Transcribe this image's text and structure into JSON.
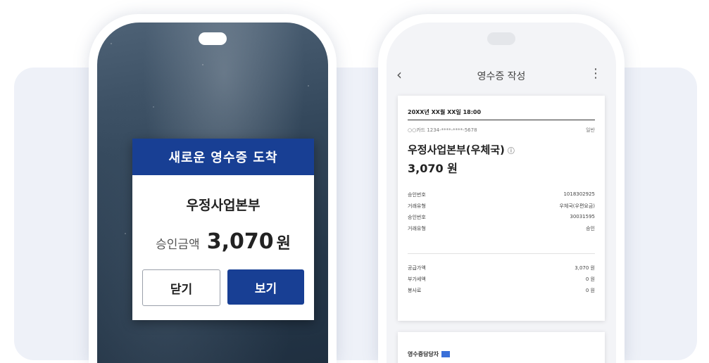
{
  "popup": {
    "title": "새로운 영수증 도착",
    "merchant": "우정사업본부",
    "amount_label": "승인금액",
    "amount_value": "3,070",
    "amount_unit": "원",
    "close_label": "닫기",
    "view_label": "보기"
  },
  "app": {
    "title": "영수증 작성"
  },
  "receipt": {
    "date": "20XX년 XX월 XX일 18:00",
    "card": "○○카드 1234-****-****-5678",
    "payment_type": "일반",
    "merchant": "우정사업본부(우체국)",
    "total": "3,070 원",
    "rows": [
      {
        "label": "승인번호",
        "value": "1018302925"
      },
      {
        "label": "거래유형",
        "value": "우체국(우편요금)"
      },
      {
        "label": "승인번호",
        "value": "30031595"
      },
      {
        "label": "거래유형",
        "value": "승인"
      }
    ],
    "amount_rows": [
      {
        "label": "공급가액",
        "value": "3,070 원"
      },
      {
        "label": "부가세액",
        "value": "0 원"
      },
      {
        "label": "봉사료",
        "value": "0 원"
      }
    ]
  },
  "receipt2": {
    "label": "영수증담당자"
  },
  "colors": {
    "brand_blue": "#183f94",
    "backdrop": "#eef1f8"
  }
}
